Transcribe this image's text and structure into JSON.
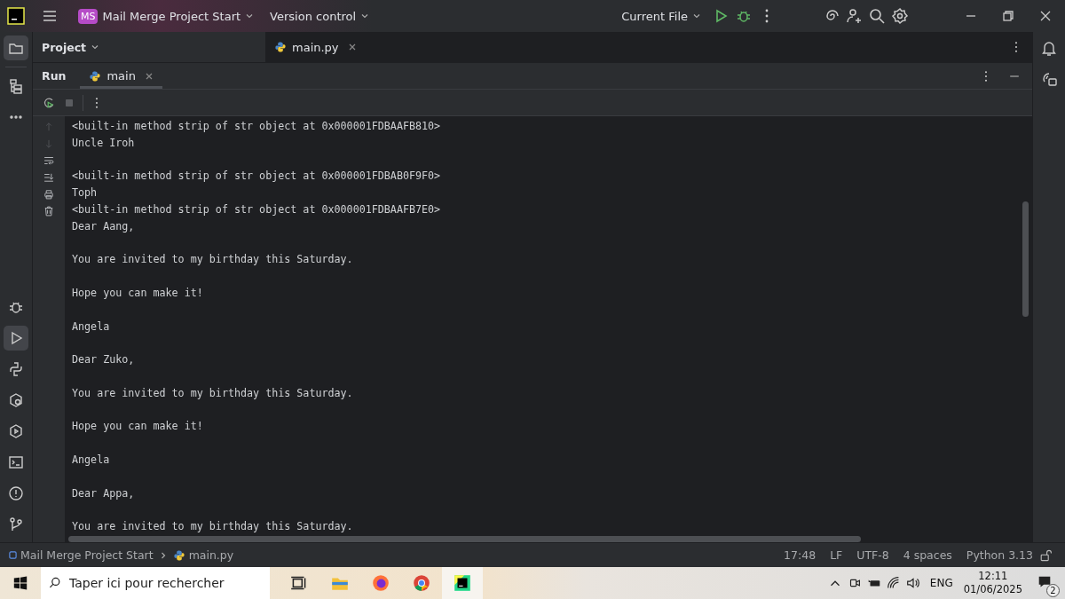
{
  "title_bar": {
    "project_badge": "MS",
    "project": "Mail Merge Project Start",
    "vcs": "Version control",
    "run_config": "Current File"
  },
  "project_panel": {
    "title": "Project"
  },
  "editor_tabs": [
    {
      "label": "main.py",
      "selected": true
    }
  ],
  "run_panel": {
    "title": "Run",
    "tabs": [
      {
        "label": "main",
        "selected": true
      }
    ]
  },
  "left_tools": [
    {
      "kind": "folder",
      "selected": true
    },
    {
      "kind": "structure",
      "selected": false
    },
    {
      "kind": "more",
      "selected": false
    },
    {
      "kind": "debug",
      "selected": false
    },
    {
      "kind": "run",
      "selected": true
    },
    {
      "kind": "python",
      "selected": false
    },
    {
      "kind": "packages",
      "selected": false
    },
    {
      "kind": "services",
      "selected": false
    },
    {
      "kind": "terminal",
      "selected": false
    },
    {
      "kind": "problems",
      "selected": false
    },
    {
      "kind": "git",
      "selected": false
    }
  ],
  "console_paragraphs": [
    {
      "lines": [
        "<built-in method strip of str object at 0x000001FDBAAFB810>",
        "Uncle Iroh"
      ]
    },
    {
      "lines": [
        "<built-in method strip of str object at 0x000001FDBAB0F9F0>",
        "Toph",
        "<built-in method strip of str object at 0x000001FDBAAFB7E0>",
        "Dear Aang,"
      ]
    },
    {
      "lines": [
        "You are invited to my birthday this Saturday."
      ]
    },
    {
      "lines": [
        "Hope you can make it!"
      ]
    },
    {
      "lines": [
        "Angela"
      ]
    },
    {
      "lines": [
        "Dear Zuko,"
      ]
    },
    {
      "lines": [
        "You are invited to my birthday this Saturday."
      ]
    },
    {
      "lines": [
        "Hope you can make it!"
      ]
    },
    {
      "lines": [
        "Angela"
      ]
    },
    {
      "lines": [
        "Dear Appa,"
      ]
    },
    {
      "lines": [
        "You are invited to my birthday this Saturday."
      ]
    }
  ],
  "status_bar": {
    "breadcrumbs": [
      "Mail Merge Project Start",
      "main.py"
    ],
    "items": [
      "17:48",
      "LF",
      "UTF-8",
      "4 spaces",
      "Python 3.13"
    ]
  },
  "taskbar": {
    "search_placeholder": "Taper ici pour rechercher",
    "language": "ENG",
    "time": "12:11",
    "date": "01/06/2025",
    "notifications": "2"
  }
}
